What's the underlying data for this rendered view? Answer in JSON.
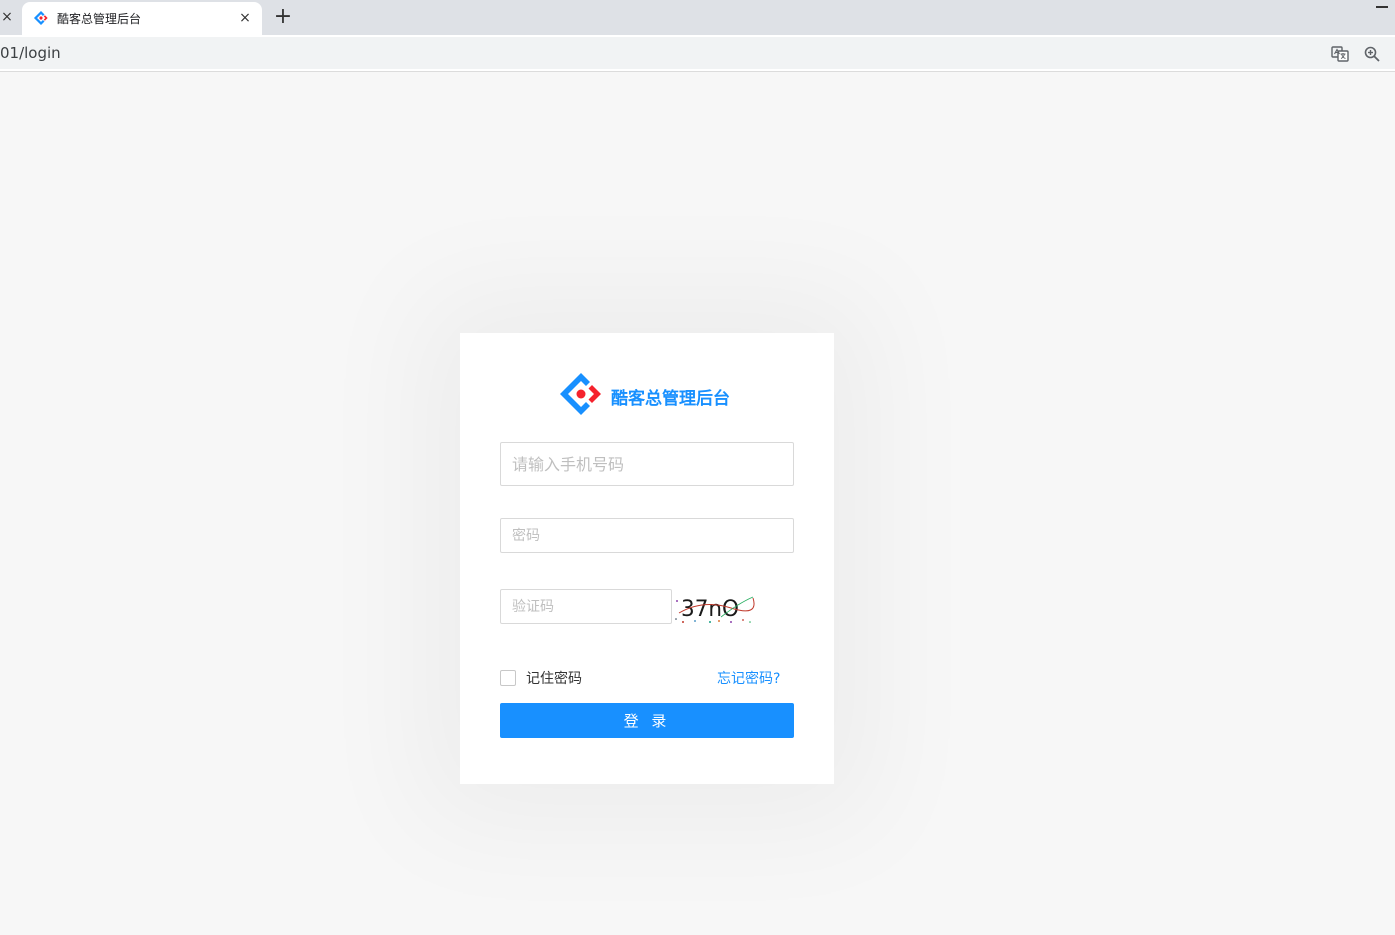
{
  "browser": {
    "tab_title": "酷客总管理后台",
    "tab_close_glyph": "×",
    "new_tab_glyph": "+",
    "url": "01/login"
  },
  "login": {
    "app_title": "酷客总管理后台",
    "phone_placeholder": "请输入手机号码",
    "password_placeholder": "密码",
    "captcha_placeholder": "验证码",
    "captcha_text": "37nO",
    "remember_label": "记住密码",
    "forgot_label": "忘记密码?",
    "login_button": "登 录"
  },
  "colors": {
    "primary": "#1890ff",
    "logo_red": "#f5222d",
    "page_bg": "#f7f7f7"
  }
}
